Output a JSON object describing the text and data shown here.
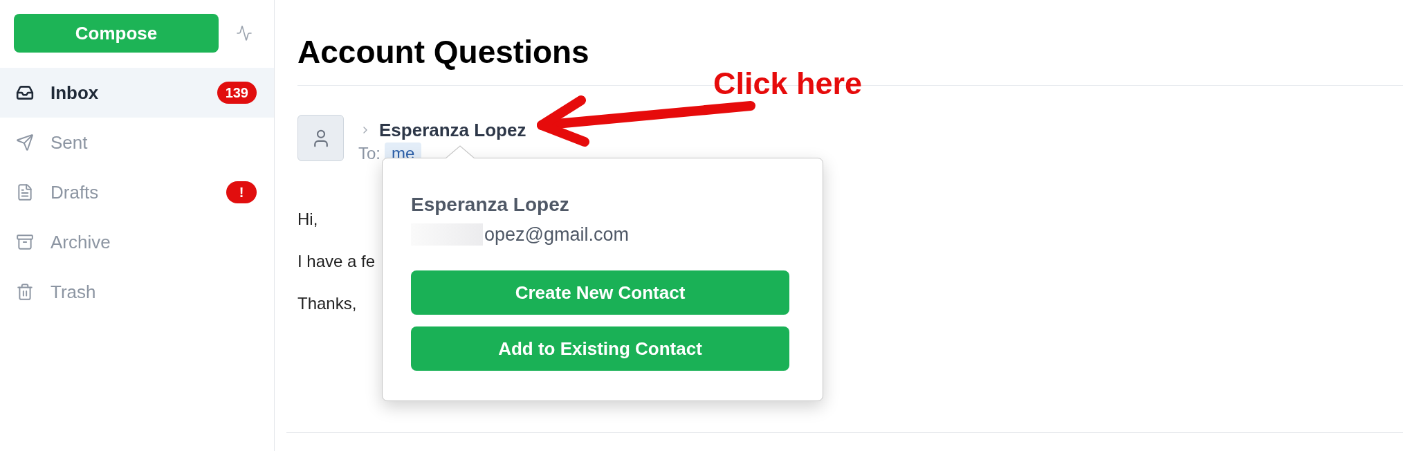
{
  "sidebar": {
    "compose_button": "Compose",
    "items": [
      {
        "label": "Inbox",
        "selected": true,
        "badge": "139"
      },
      {
        "label": "Sent",
        "selected": false
      },
      {
        "label": "Drafts",
        "selected": false,
        "badge": "!"
      },
      {
        "label": "Archive",
        "selected": false
      },
      {
        "label": "Trash",
        "selected": false
      }
    ]
  },
  "message": {
    "subject": "Account Questions",
    "sender": {
      "name": "Esperanza Lopez",
      "expanded": false,
      "to_label": "To:",
      "to_recipient": "me"
    },
    "body": [
      "Hi,",
      "I have a fe",
      "Thanks,"
    ]
  },
  "contact_popover": {
    "name": "Esperanza Lopez",
    "email": "opez@gmail.com",
    "email_prefix_redacted": true,
    "buttons": [
      "Create New Contact",
      "Add to Existing Contact"
    ]
  },
  "annotation": {
    "text": "Click here"
  }
}
